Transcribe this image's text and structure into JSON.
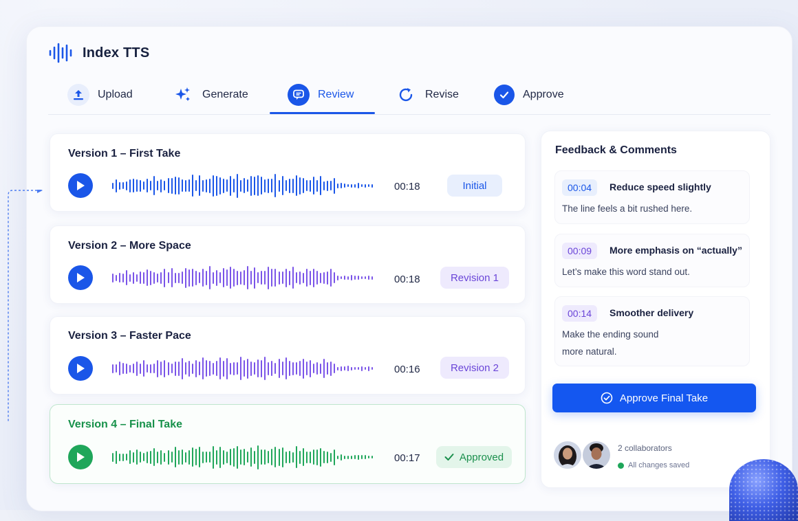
{
  "app": {
    "title": "Index TTS"
  },
  "tabs": [
    {
      "label": "Upload",
      "icon": "upload-icon"
    },
    {
      "label": "Generate",
      "icon": "sparkle-icon"
    },
    {
      "label": "Review",
      "icon": "chat-icon",
      "active": true
    },
    {
      "label": "Revise",
      "icon": "refresh-icon"
    },
    {
      "label": "Approve",
      "icon": "check-circle-icon"
    }
  ],
  "versions": [
    {
      "title": "Version 1 – First Take",
      "duration": "00:18",
      "badge": "Initial",
      "color": "#1a56e8"
    },
    {
      "title": "Version 2 – More Space",
      "duration": "00:18",
      "badge": "Revision 1",
      "color": "#7a54e8"
    },
    {
      "title": "Version 3 – Faster Pace",
      "duration": "00:16",
      "badge": "Revision 2",
      "color": "#7a54e8"
    },
    {
      "title": "Version 4 – Final Take",
      "duration": "00:17",
      "badge": "Approved",
      "color": "#1fa65a"
    }
  ],
  "feedback": {
    "title": "Feedback & Comments",
    "items": [
      {
        "time": "00:04",
        "heading": "Reduce speed slightly",
        "body": "The line feels a bit rushed here."
      },
      {
        "time": "00:09",
        "heading": "More emphasis on “actually”",
        "body": "Let’s make this word stand out."
      },
      {
        "time": "00:14",
        "heading": "Smoother delivery",
        "body_line1": "Make the ending sound",
        "body_line2": "more natural."
      }
    ],
    "approve_label": "Approve Final Take",
    "collaborators": "2 collaborators",
    "saved": "All changes saved"
  },
  "colors": {
    "accent": "#1457f0",
    "success": "#1fa65a",
    "revision": "#7a54e8"
  }
}
